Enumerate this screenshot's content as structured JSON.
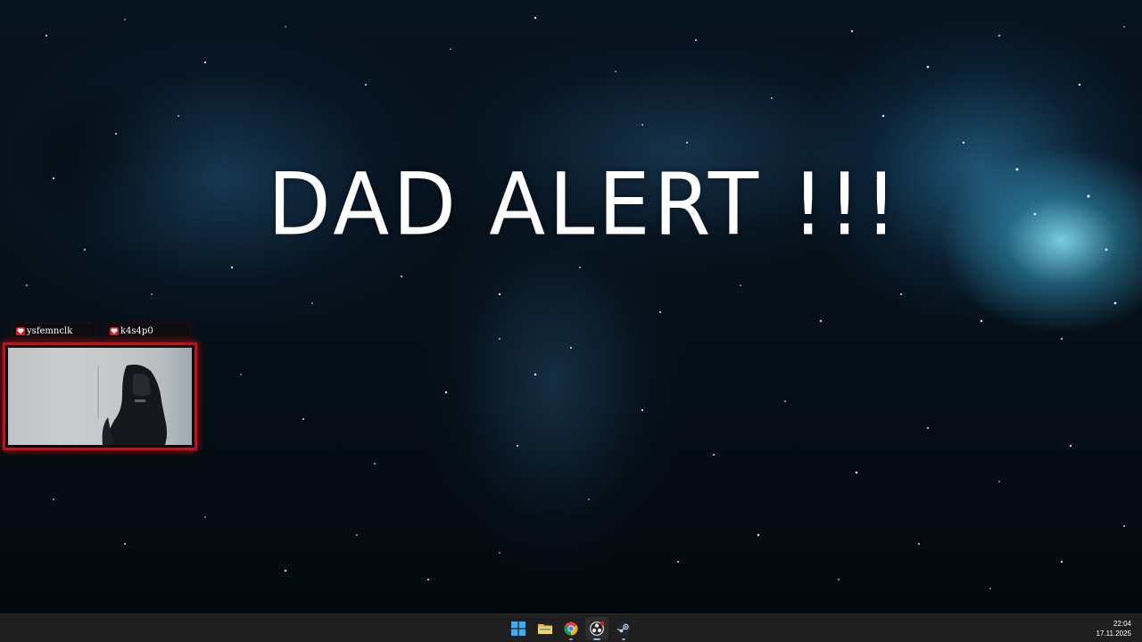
{
  "overlay": {
    "title": "DAD ALERT !!!"
  },
  "webcam": {
    "names": [
      "ysfemnclk",
      "k4s4p0"
    ]
  },
  "taskbar": {
    "apps": [
      {
        "name": "start",
        "icon": "windows-start-icon"
      },
      {
        "name": "file-explorer",
        "icon": "folder-icon"
      },
      {
        "name": "chrome",
        "icon": "chrome-icon"
      },
      {
        "name": "obs",
        "icon": "obs-icon"
      },
      {
        "name": "steam",
        "icon": "steam-icon"
      }
    ],
    "clock": {
      "time": "22:04",
      "date": "17.11.2025"
    }
  },
  "colors": {
    "overlay_text": "#ffffff",
    "cam_border": "#c1121a",
    "taskbar_bg": "#1f1f1f"
  }
}
